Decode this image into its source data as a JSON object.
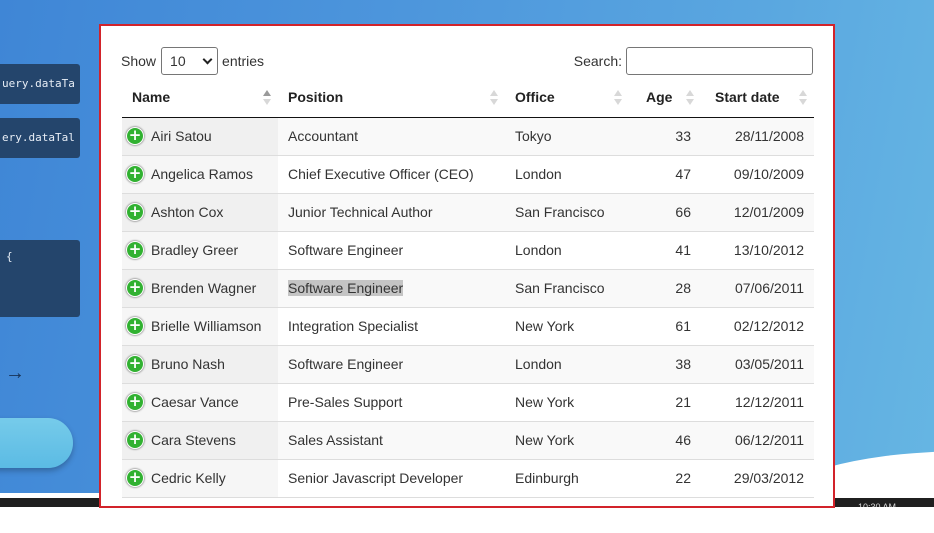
{
  "background": {
    "code_snippets": [
      "uery.dataTa",
      "ery.dataTal",
      "{"
    ],
    "arrow_glyph": "→"
  },
  "table_controls": {
    "show_label": "Show",
    "entries_value": "10",
    "entries_label": "entries",
    "search_label": "Search:",
    "search_value": ""
  },
  "table": {
    "columns": [
      "Name",
      "Position",
      "Office",
      "Age",
      "Start date"
    ],
    "rows": [
      {
        "name": "Airi Satou",
        "position": "Accountant",
        "office": "Tokyo",
        "age": "33",
        "start": "28/11/2008"
      },
      {
        "name": "Angelica Ramos",
        "position": "Chief Executive Officer (CEO)",
        "office": "London",
        "age": "47",
        "start": "09/10/2009"
      },
      {
        "name": "Ashton Cox",
        "position": "Junior Technical Author",
        "office": "San Francisco",
        "age": "66",
        "start": "12/01/2009"
      },
      {
        "name": "Bradley Greer",
        "position": "Software Engineer",
        "office": "London",
        "age": "41",
        "start": "13/10/2012"
      },
      {
        "name": "Brenden Wagner",
        "position": "Software Engineer",
        "office": "San Francisco",
        "age": "28",
        "start": "07/06/2011"
      },
      {
        "name": "Brielle Williamson",
        "position": "Integration Specialist",
        "office": "New York",
        "age": "61",
        "start": "02/12/2012"
      },
      {
        "name": "Bruno Nash",
        "position": "Software Engineer",
        "office": "London",
        "age": "38",
        "start": "03/05/2011"
      },
      {
        "name": "Caesar Vance",
        "position": "Pre-Sales Support",
        "office": "New York",
        "age": "21",
        "start": "12/12/2011"
      },
      {
        "name": "Cara Stevens",
        "position": "Sales Assistant",
        "office": "New York",
        "age": "46",
        "start": "06/12/2011"
      },
      {
        "name": "Cedric Kelly",
        "position": "Senior Javascript Developer",
        "office": "Edinburgh",
        "age": "22",
        "start": "29/03/2012"
      }
    ],
    "expand_glyph": "+"
  },
  "taskbar": {
    "clock": "10:30 AM"
  },
  "colors": {
    "modal_border": "#d2232a",
    "expand_button": "#31b131",
    "background_blue": "#4d96dc",
    "code_box": "#24456c"
  }
}
